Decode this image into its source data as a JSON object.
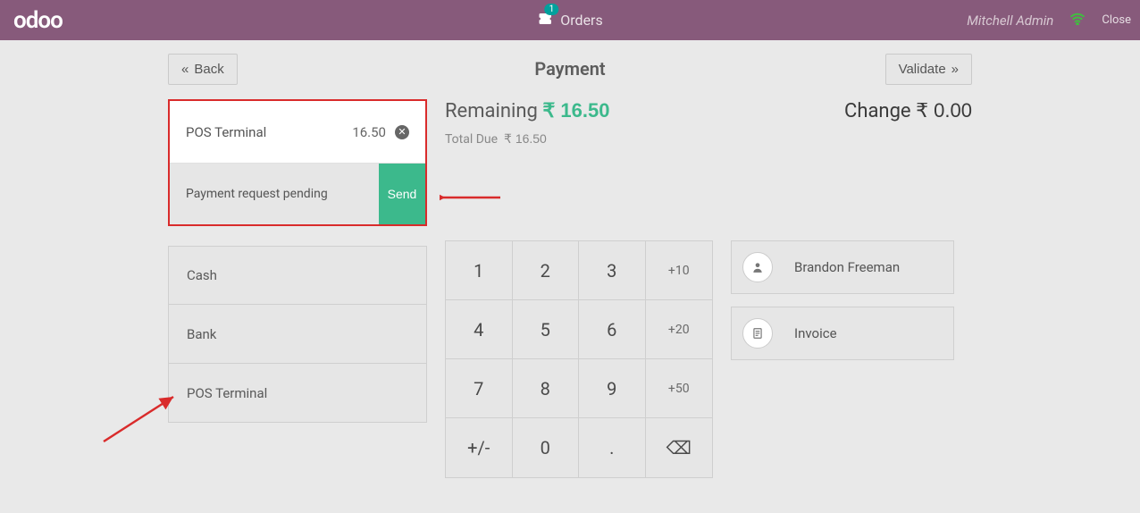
{
  "topbar": {
    "logo": "odoo",
    "orders_label": "Orders",
    "orders_count": "1",
    "user": "Mitchell Admin",
    "close": "Close"
  },
  "header": {
    "back": "Back",
    "title": "Payment",
    "validate": "Validate"
  },
  "active_line": {
    "method": "POS Terminal",
    "amount": "16.50",
    "pending_msg": "Payment request pending",
    "send": "Send"
  },
  "amounts": {
    "remaining_label": "Remaining",
    "remaining_value": "₹ 16.50",
    "total_due_label": "Total Due",
    "total_due_value": "₹ 16.50",
    "change_label": "Change",
    "change_value": "₹ 0.00"
  },
  "methods": [
    "Cash",
    "Bank",
    "POS Terminal"
  ],
  "keypad": {
    "r0": [
      "1",
      "2",
      "3",
      "+10"
    ],
    "r1": [
      "4",
      "5",
      "6",
      "+20"
    ],
    "r2": [
      "7",
      "8",
      "9",
      "+50"
    ],
    "r3": [
      "+/-",
      "0",
      ".",
      "⌫"
    ]
  },
  "side": {
    "customer": "Brandon Freeman",
    "invoice": "Invoice"
  }
}
